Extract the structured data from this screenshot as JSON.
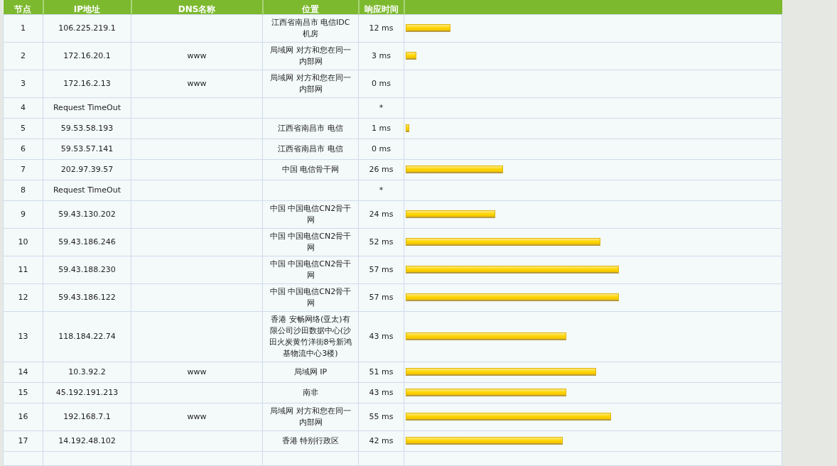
{
  "table": {
    "columns": [
      "节点",
      "IP地址",
      "DNS名称",
      "位置",
      "响应时间"
    ],
    "rows": [
      {
        "hop": "1",
        "ip": "106.225.219.1",
        "dns": "",
        "location": "江西省南昌市 电信IDC机房",
        "time": "12 ms",
        "level": 0.12
      },
      {
        "hop": "2",
        "ip": "172.16.20.1",
        "dns": "www",
        "location": "局域网 对方和您在同一内部网",
        "time": "3 ms",
        "level": 0.029
      },
      {
        "hop": "3",
        "ip": "172.16.2.13",
        "dns": "www",
        "location": "局域网 对方和您在同一内部网",
        "time": "0 ms"
      },
      {
        "hop": "4",
        "ip": "Request TimeOut",
        "dns": "",
        "location": "",
        "time": "*"
      },
      {
        "hop": "5",
        "ip": "59.53.58.193",
        "dns": "",
        "location": "江西省南昌市 电信",
        "time": "1 ms",
        "level": 0.01
      },
      {
        "hop": "6",
        "ip": "59.53.57.141",
        "dns": "",
        "location": "江西省南昌市 电信",
        "time": "0 ms"
      },
      {
        "hop": "7",
        "ip": "202.97.39.57",
        "dns": "",
        "location": "中国 电信骨干网",
        "time": "26 ms",
        "level": 0.26
      },
      {
        "hop": "8",
        "ip": "Request TimeOut",
        "dns": "",
        "location": "",
        "time": "*"
      },
      {
        "hop": "9",
        "ip": "59.43.130.202",
        "dns": "",
        "location": "中国 中国电信CN2骨干网",
        "time": "24 ms",
        "level": 0.24
      },
      {
        "hop": "10",
        "ip": "59.43.186.246",
        "dns": "",
        "location": "中国 中国电信CN2骨干网",
        "time": "52 ms",
        "level": 0.52
      },
      {
        "hop": "11",
        "ip": "59.43.188.230",
        "dns": "",
        "location": "中国 中国电信CN2骨干网",
        "time": "57 ms",
        "level": 0.57
      },
      {
        "hop": "12",
        "ip": "59.43.186.122",
        "dns": "",
        "location": "中国 中国电信CN2骨干网",
        "time": "57 ms",
        "level": 0.57
      },
      {
        "hop": "13",
        "ip": "118.184.22.74",
        "dns": "",
        "location": "香港 安畅网络(亚太)有限公司沙田数据中心(沙田火炭黄竹洋街8号新鸿基物流中心3楼)",
        "time": "43 ms",
        "level": 0.43
      },
      {
        "hop": "14",
        "ip": "10.3.92.2",
        "dns": "www",
        "location": "局域网 IP",
        "time": "51 ms",
        "level": 0.51
      },
      {
        "hop": "15",
        "ip": "45.192.191.213",
        "dns": "",
        "location": "南非",
        "time": "43 ms",
        "level": 0.43
      },
      {
        "hop": "16",
        "ip": "192.168.7.1",
        "dns": "www",
        "location": "局域网 对方和您在同一内部网",
        "time": "55 ms",
        "level": 0.55
      },
      {
        "hop": "17",
        "ip": "14.192.48.102",
        "dns": "",
        "location": "香港 特别行政区",
        "time": "42 ms",
        "level": 0.42
      }
    ]
  }
}
